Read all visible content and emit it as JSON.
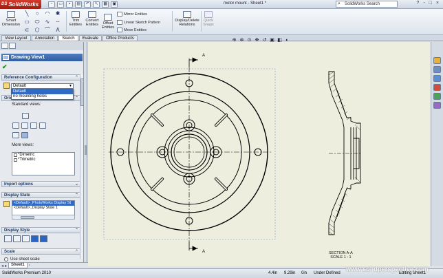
{
  "app": {
    "logo": "SolidWorks",
    "logo_prefix": "DS",
    "document_title": "motor mount - Sheet1 *",
    "search_placeholder": "SolidWorks Search",
    "window_controls": [
      "?",
      "-",
      "□",
      "×"
    ]
  },
  "ribbon": {
    "smart_dimension": "Smart Dimension",
    "trim_entities": "Trim Entities",
    "convert_entities": "Convert Entities",
    "offset_entities": "Offset Entities",
    "mirror_entities": "Mirror Entities",
    "linear_sketch_pattern": "Linear Sketch Pattern",
    "move_entities": "Move Entities",
    "display_delete_relations": "Display/Delete Relations",
    "quick_snaps": "Quick Snaps"
  },
  "tabs": [
    {
      "label": "View Layout",
      "active": false
    },
    {
      "label": "Annotation",
      "active": false
    },
    {
      "label": "Sketch",
      "active": true
    },
    {
      "label": "Evaluate",
      "active": false
    },
    {
      "label": "Office Products",
      "active": false
    }
  ],
  "panel": {
    "title": "Drawing View1",
    "reference_configuration": {
      "header": "Reference Configuration",
      "selected": "Default",
      "options": [
        "Default",
        "no mounting holes"
      ]
    },
    "orientation": {
      "header": "Orie",
      "standard_views_label": "Standard views:",
      "more_views_label": "More views:",
      "more_views": [
        "*Dimetric",
        "*Trimetric"
      ]
    },
    "import_options": {
      "header": "Import options"
    },
    "display_state": {
      "header": "Display State",
      "items": [
        "<Default>_PhotoWorks Display St",
        "<Default>_Display State 1"
      ]
    },
    "display_style": {
      "header": "Display Style"
    },
    "scale": {
      "header": "Scale",
      "use_sheet_scale": "Use sheet scale"
    }
  },
  "drawing": {
    "section_marker_top": "A",
    "section_marker_bottom": "A",
    "section_title": "SECTION A-A",
    "section_scale": "SCALE 1 : 1"
  },
  "sheets": {
    "tab_label": "Sheet1"
  },
  "status": {
    "product": "SolidWorks Premium 2010",
    "x": "4.4in",
    "y": "9.29in",
    "z": "0in",
    "state": "Under Defined",
    "editing": "Editing Sheet1"
  },
  "watermark": "www.solidperspective.com"
}
